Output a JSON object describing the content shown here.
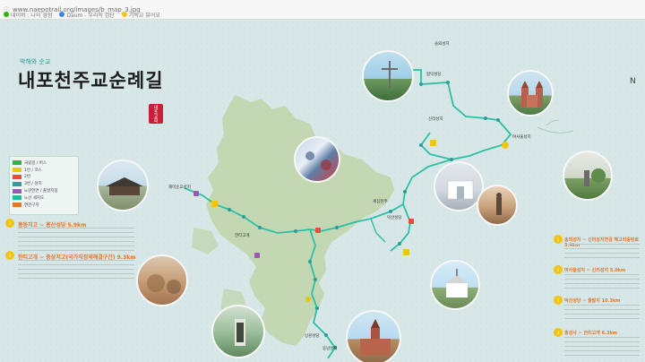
{
  "browser": {
    "url": "www.naepotrail.org/images/b_map_3.jpg",
    "bookmarks": [
      {
        "label": "네이버 : 나의 경험",
        "color": "#2db400"
      },
      {
        "label": "Daum - 우리의 검단",
        "color": "#3b82f6"
      },
      {
        "label": "기독교 뷰어요",
        "color": "#f5c518"
      }
    ]
  },
  "title": {
    "subtitle": "박해와 순교",
    "main": "내포천주교순례길",
    "seal": "내포교회"
  },
  "legend": {
    "items": [
      {
        "label": "국립길 / 버스",
        "color": "#2db34a"
      },
      {
        "label": "1번 / 코스",
        "color": "#f1c40f"
      },
      {
        "label": "2번",
        "color": "#e74c3c"
      },
      {
        "label": "3번 / 성지",
        "color": "#2f9b9a"
      },
      {
        "label": "노란연면 / 출발지점",
        "color": "#9b59b6"
      },
      {
        "label": "노선 세지도",
        "color": "#1abc9c"
      },
      {
        "label": "연관구지",
        "color": "#e0772b"
      }
    ]
  },
  "courses": [
    {
      "id": "1",
      "title": "솔뫼성지 ~ 신리성지연결 해고리중턴로 5.4km"
    },
    {
      "id": "2",
      "title": "여사울성지 ~ 신리성지 5.0km"
    },
    {
      "id": "3",
      "title": "덕산성당 ~ 출발지 10.3km"
    },
    {
      "id": "4",
      "title": "홍성사 ~ 한티고개 6.3km"
    }
  ],
  "left_courses": [
    {
      "id": "1",
      "title": "홍동지고 ~ 홍산성당 5.9km"
    },
    {
      "id": "2",
      "title": "한티고개 ~ 중상지고(국가지정재해결구간) 9.3km"
    }
  ],
  "places": {
    "haemi": "해미순교성지",
    "solmoe": "솔뫼성지",
    "hapdeok": "합덕성당",
    "yeosaul": "여사울성지",
    "sinri": "신리성지",
    "deoksan": "덕산성당",
    "hwangmoo": "한티고개",
    "seosan": "상원성당",
    "tabli": "세심천주",
    "dongdu": "동남성지"
  },
  "compass": "N"
}
